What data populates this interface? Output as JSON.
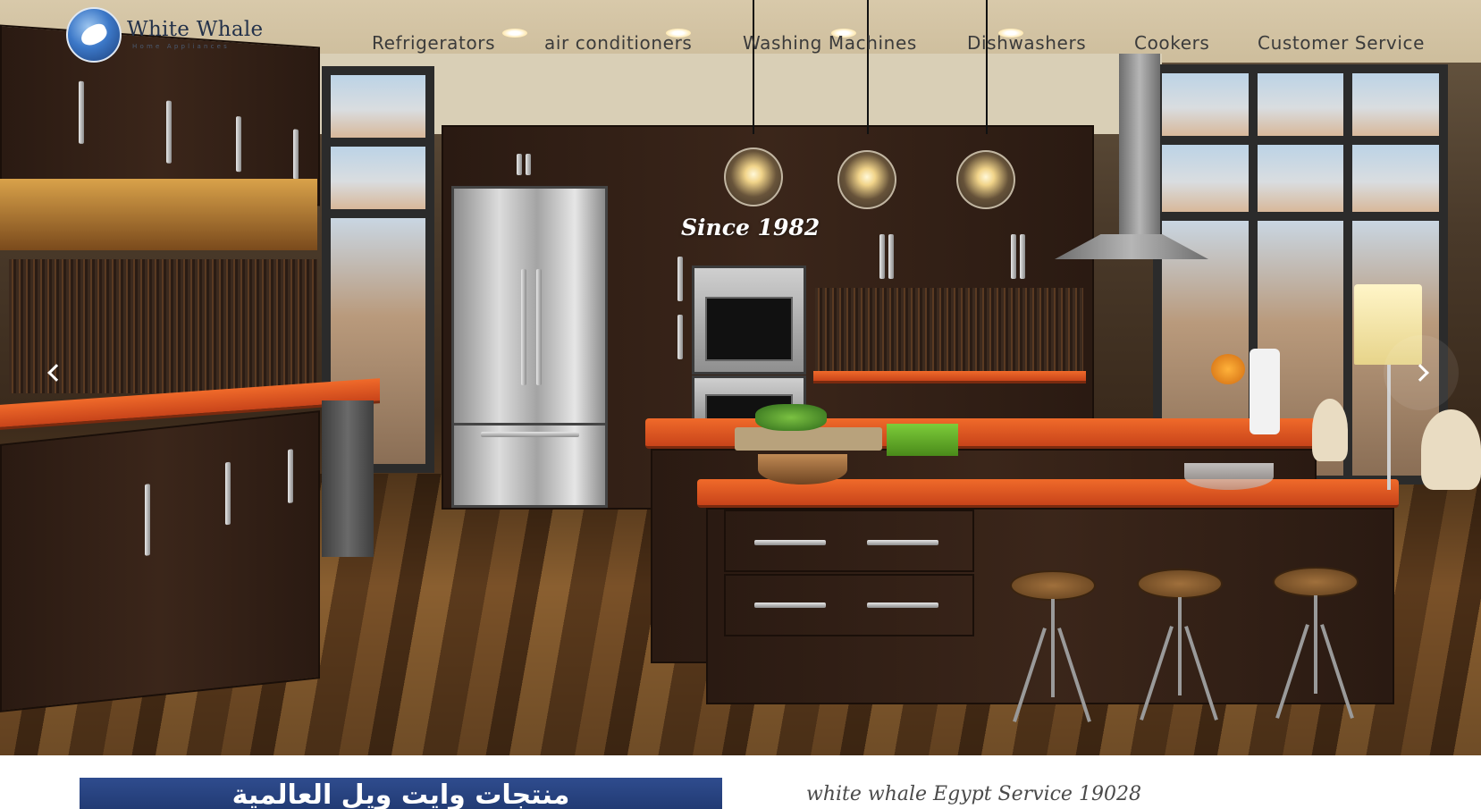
{
  "brand": {
    "name": "White Whale",
    "subtitle": "Home Appliances",
    "logo_icon": "whale-logo-icon"
  },
  "nav": {
    "items": [
      {
        "label": "Refrigerators"
      },
      {
        "label": "air conditioners"
      },
      {
        "label": "Washing Machines"
      },
      {
        "label": "Dishwashers"
      },
      {
        "label": "Cookers"
      },
      {
        "label": "Customer Service"
      }
    ]
  },
  "hero": {
    "tagline": "Since 1982",
    "prev_icon": "chevron-left-icon",
    "next_icon": "chevron-right-icon"
  },
  "banner": {
    "arabic_text": "منتجات وايت ويل العالمية",
    "background_color": "#2a4483"
  },
  "service": {
    "text": "white whale Egypt Service 19028"
  },
  "colors": {
    "accent_orange": "#e8622a",
    "nav_text": "#3b3b3b",
    "brand_blue": "#3c78c8"
  }
}
